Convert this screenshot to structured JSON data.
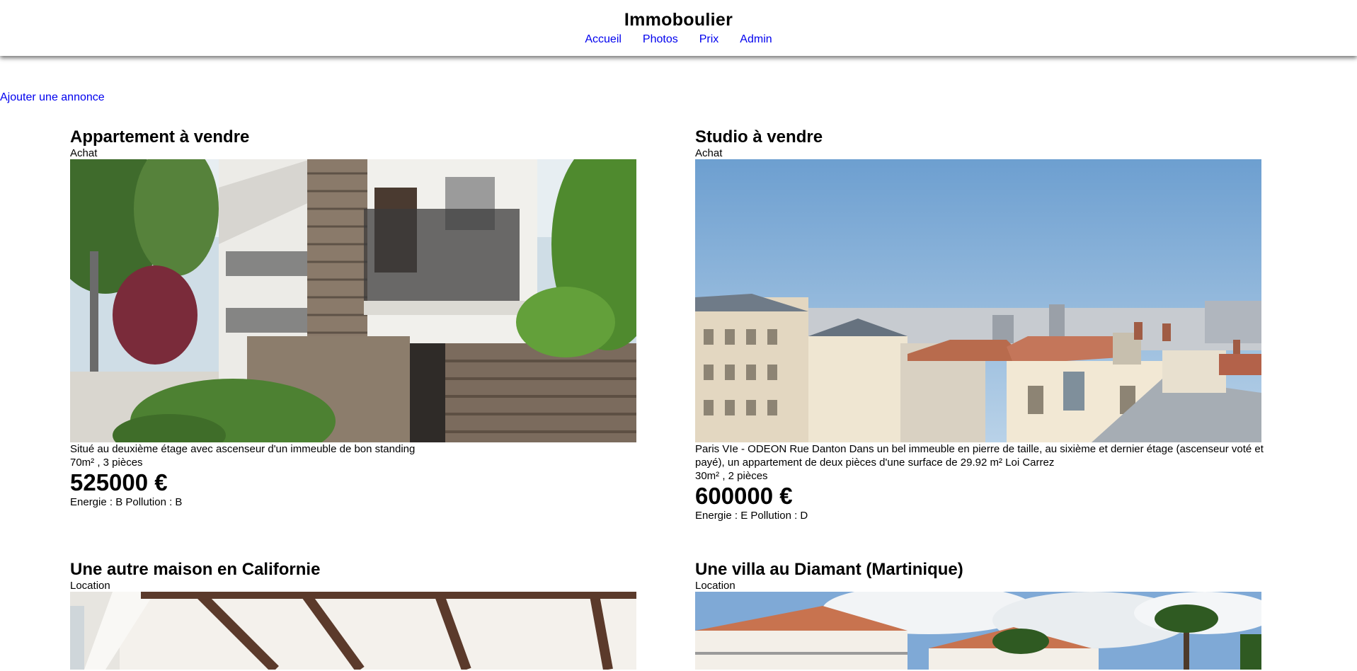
{
  "site": {
    "title": "Immoboulier",
    "nav": [
      "Accueil",
      "Photos",
      "Prix",
      "Admin"
    ]
  },
  "add_link": "Ajouter une annonce",
  "listings": [
    {
      "title": "Appartement à vendre",
      "type": "Achat",
      "photo": "apartment-building-photo",
      "description": "Situé au deuxième étage avec ascenseur d'un immeuble de bon standing",
      "specs": "70m² , 3 pièces",
      "price": "525000 €",
      "energy": "Energie : B Pollution : B"
    },
    {
      "title": "Studio à vendre",
      "type": "Achat",
      "photo": "paris-rooftops-photo",
      "description": "Paris VIe - ODEON Rue Danton Dans un bel immeuble en pierre de taille, au sixième et dernier étage (ascenseur voté et payé), un appartement de deux pièces d'une surface de 29.92 m² Loi Carrez",
      "specs": "30m² , 2 pièces",
      "price": "600000 €",
      "energy": "Energie : E Pollution : D"
    },
    {
      "title": "Une autre maison en Californie",
      "type": "Location",
      "photo": "pergola-house-photo"
    },
    {
      "title": "Une villa au Diamant (Martinique)",
      "type": "Location",
      "photo": "martinique-villa-photo"
    }
  ]
}
